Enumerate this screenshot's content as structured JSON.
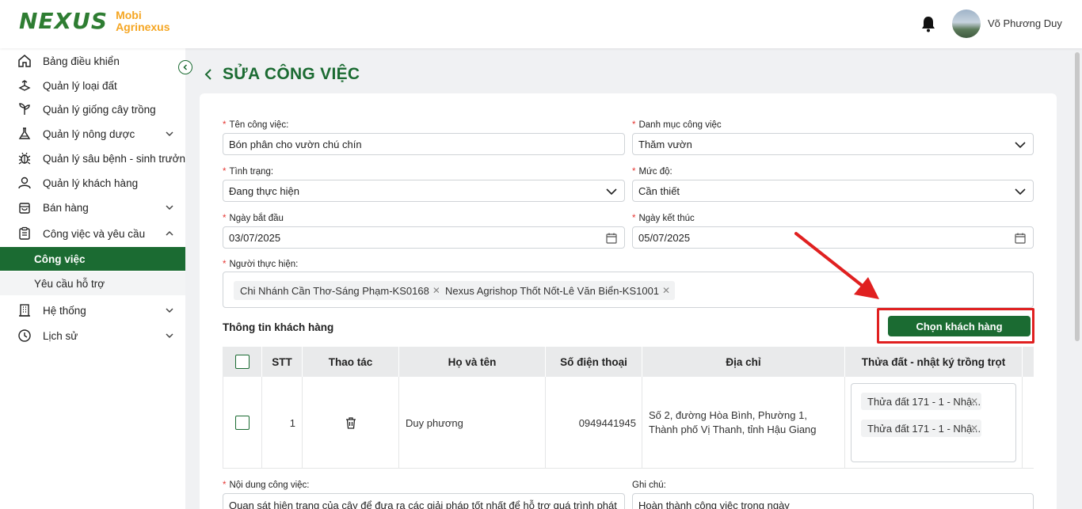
{
  "header": {
    "brand_mark": "NEXUS",
    "brand_line1": "Mobi",
    "brand_line2": "Agrinexus",
    "user_name": "Võ Phương Duy"
  },
  "sidebar": {
    "items": [
      {
        "label": "Bảng điều khiển",
        "icon": "dashboard-icon"
      },
      {
        "label": "Quản lý loại đất",
        "icon": "soil-icon"
      },
      {
        "label": "Quản lý giống cây trồng",
        "icon": "plant-icon"
      },
      {
        "label": "Quản lý nông dược",
        "icon": "flask-icon",
        "expandable": true
      },
      {
        "label": "Quản lý sâu bệnh - sinh trưởng",
        "icon": "bug-icon"
      },
      {
        "label": "Quản lý khách hàng",
        "icon": "user-icon"
      },
      {
        "label": "Bán hàng",
        "icon": "bag-icon",
        "expandable": true
      },
      {
        "label": "Công việc và yêu cầu",
        "icon": "clipboard-icon",
        "expandable": true,
        "expanded": true
      },
      {
        "label": "Hệ thống",
        "icon": "building-icon",
        "expandable": true
      },
      {
        "label": "Lịch sử",
        "icon": "history-icon",
        "expandable": true
      }
    ],
    "subitems": [
      {
        "label": "Công việc",
        "active": true
      },
      {
        "label": "Yêu cầu hỗ trợ",
        "active": false
      }
    ]
  },
  "page": {
    "title": "SỬA CÔNG VIỆC"
  },
  "form": {
    "task_name_label": "Tên công việc:",
    "task_name_value": "Bón phân cho vườn chú chín",
    "category_label": "Danh mục công việc",
    "category_value": "Thăm vườn",
    "status_label": "Tình trạng:",
    "status_value": "Đang thực hiện",
    "priority_label": "Mức độ:",
    "priority_value": "Cần thiết",
    "start_label": "Ngày bắt đầu",
    "start_value": "03/07/2025",
    "end_label": "Ngày kết thúc",
    "end_value": "05/07/2025",
    "assignee_label": "Người thực hiện:",
    "assignees": [
      "Chi Nhánh Cần Thơ-Sáng Phạm-KS0168",
      "Nexus Agrishop Thốt Nốt-Lê  Văn Biển-KS1001"
    ],
    "content_label": "Nội dung công việc:",
    "content_value": "Quan sát hiện trạng của cây để đưa ra các giải pháp tốt nhất để hỗ trợ quá trình phát",
    "note_label": "Ghi chú:",
    "note_value": "Hoàn thành công việc trong ngày"
  },
  "customers": {
    "section_title": "Thông tin khách hàng",
    "choose_button": "Chọn khách hàng",
    "columns": [
      "STT",
      "Thao tác",
      "Họ và tên",
      "Số điện thoại",
      "Địa chỉ",
      "Thửa đất - nhật ký trồng trọt"
    ],
    "rows": [
      {
        "stt": "1",
        "name": "Duy phương",
        "phone": "0949441945",
        "address": "Số 2, đường Hòa Bình, Phường 1, Thành phố Vị Thanh, tỉnh Hậu Giang",
        "plots": [
          "Thửa đất 171 - 1 - Nhậ...",
          "Thửa đất 171 - 1 - Nhậ..."
        ]
      }
    ]
  },
  "colors": {
    "primary": "#1b6b32",
    "accent": "#f5a623",
    "annotation": "#e02020"
  }
}
